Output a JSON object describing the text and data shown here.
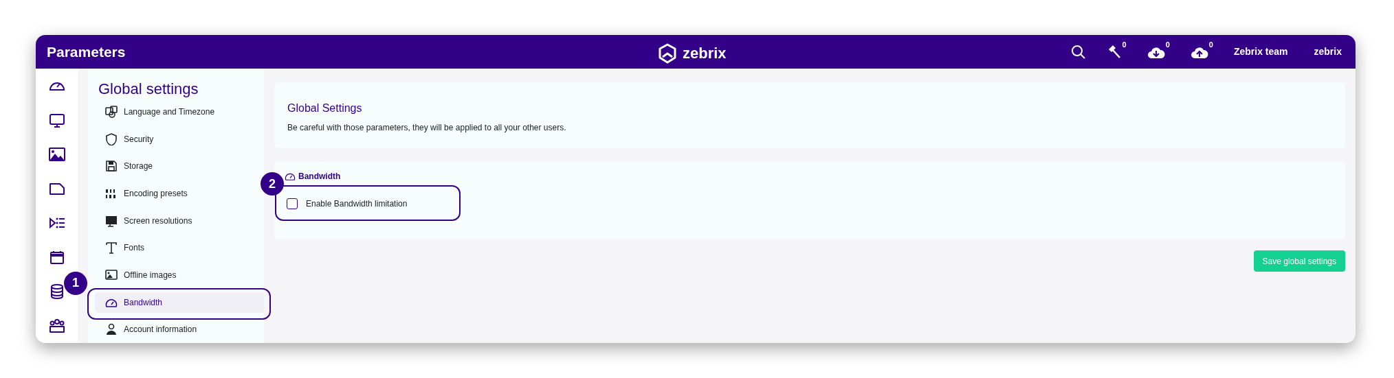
{
  "header": {
    "title": "Parameters",
    "logo_text": "zebrix",
    "indicators": [
      {
        "kind": "tool",
        "count": "0"
      },
      {
        "kind": "download",
        "count": "0"
      },
      {
        "kind": "upload",
        "count": "0"
      }
    ],
    "team": "Zebrix team",
    "user": "zebrix"
  },
  "sidebar": {
    "title": "Global settings",
    "items": [
      {
        "label": "Language and Timezone",
        "selected": false
      },
      {
        "label": "Security",
        "selected": false
      },
      {
        "label": "Storage",
        "selected": false
      },
      {
        "label": "Encoding presets",
        "selected": false
      },
      {
        "label": "Screen resolutions",
        "selected": false
      },
      {
        "label": "Fonts",
        "selected": false
      },
      {
        "label": "Offline images",
        "selected": false
      },
      {
        "label": "Bandwidth",
        "selected": true,
        "callout": "1"
      },
      {
        "label": "Account information",
        "selected": false
      }
    ]
  },
  "intro": {
    "title": "Global Settings",
    "text": "Be careful with those parameters, they will be applied to all your other users."
  },
  "section": {
    "title": "Bandwidth",
    "options": [
      {
        "label": "Enable Bandwidth limitation",
        "checked": false,
        "callout": "2"
      }
    ]
  },
  "save_button": "Save global settings"
}
